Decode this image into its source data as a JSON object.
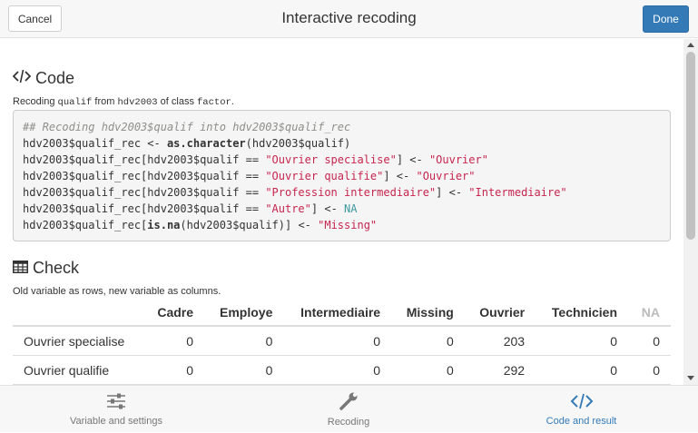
{
  "header": {
    "cancel_label": "Cancel",
    "title": "Interactive recoding",
    "done_label": "Done"
  },
  "code_section": {
    "heading": "Code",
    "desc_prefix": "Recoding ",
    "desc_var": "qualif",
    "desc_from": " from ",
    "desc_df": "hdv2003",
    "desc_of": " of class ",
    "desc_class": "factor",
    "desc_end": "."
  },
  "code_lines": {
    "l1": "## Recoding hdv2003$qualif into hdv2003$qualif_rec",
    "l2a": "hdv2003$qualif_rec <- ",
    "l2kw": "as.character",
    "l2b": "(hdv2003$qualif)",
    "l3a": "hdv2003$qualif_rec[hdv2003$qualif == ",
    "l3s1": "\"Ouvrier specialise\"",
    "l3b": "] <- ",
    "l3s2": "\"Ouvrier\"",
    "l4a": "hdv2003$qualif_rec[hdv2003$qualif == ",
    "l4s1": "\"Ouvrier qualifie\"",
    "l4b": "] <- ",
    "l4s2": "\"Ouvrier\"",
    "l5a": "hdv2003$qualif_rec[hdv2003$qualif == ",
    "l5s1": "\"Profession intermediaire\"",
    "l5b": "] <- ",
    "l5s2": "\"Intermediaire\"",
    "l6a": "hdv2003$qualif_rec[hdv2003$qualif == ",
    "l6s1": "\"Autre\"",
    "l6b": "] <- ",
    "l6na": "NA",
    "l7a": "hdv2003$qualif_rec[",
    "l7kw": "is.na",
    "l7b": "(hdv2003$qualif)] <- ",
    "l7s": "\"Missing\""
  },
  "check_section": {
    "heading": "Check",
    "desc": "Old variable as rows, new variable as columns."
  },
  "table": {
    "columns": [
      "",
      "Cadre",
      "Employe",
      "Intermediaire",
      "Missing",
      "Ouvrier",
      "Technicien",
      "NA"
    ],
    "rows": [
      {
        "label": "Ouvrier specialise",
        "values": [
          "0",
          "0",
          "0",
          "0",
          "203",
          "0",
          "0"
        ]
      },
      {
        "label": "Ouvrier qualifie",
        "values": [
          "0",
          "0",
          "0",
          "0",
          "292",
          "0",
          "0"
        ]
      }
    ]
  },
  "tabs": [
    {
      "label": "Variable and settings",
      "icon": "sliders-icon"
    },
    {
      "label": "Recoding",
      "icon": "wrench-icon"
    },
    {
      "label": "Code and result",
      "icon": "code-icon",
      "active": true
    }
  ],
  "colors": {
    "primary": "#337ab7",
    "string": "#c7254e",
    "na_keyword": "#3e999f",
    "comment": "#8e908c"
  }
}
